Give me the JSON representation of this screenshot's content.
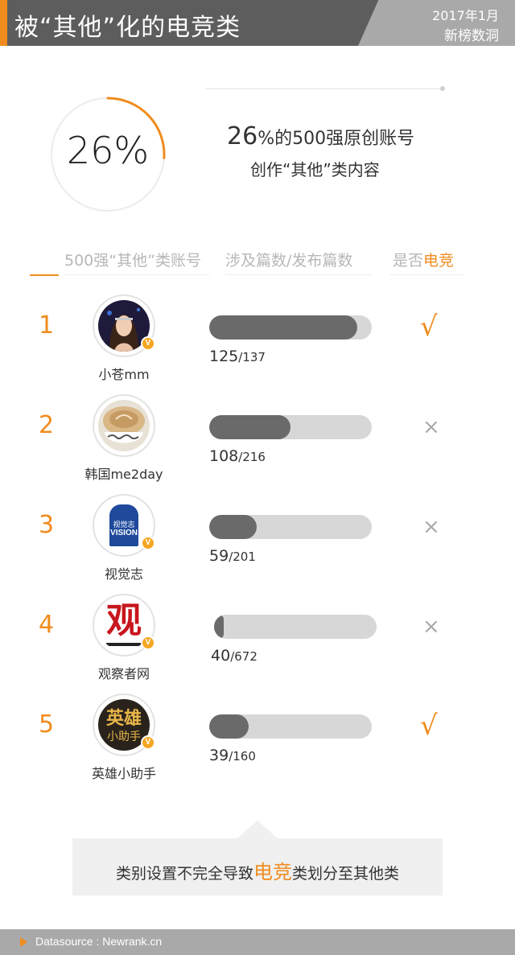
{
  "header": {
    "title": "被“其他”化的电竞类",
    "date": "2017年1月",
    "brand": "新榜数洞"
  },
  "stat": {
    "percent_value": 26,
    "ring_label": "26%",
    "line1_number": "26",
    "line1_rest": "%的500强原创账号",
    "line2": "创作“其他”类内容"
  },
  "columns": {
    "account": "500强“其他”类账号",
    "posts": "涉及篇数/发布篇数",
    "esports_prefix": "是否",
    "esports_highlight": "电竞"
  },
  "chart_data": {
    "type": "bar",
    "categories": [
      "小苍mm",
      "韩国me2day",
      "视觉志",
      "观察者网",
      "英雄小助手"
    ],
    "series": [
      {
        "values": [
          125,
          108,
          59,
          40,
          39
        ]
      },
      {
        "values": [
          137,
          216,
          201,
          672,
          160
        ]
      }
    ],
    "ranks": [
      "1",
      "2",
      "3",
      "4",
      "5"
    ],
    "is_esports": [
      true,
      false,
      false,
      false,
      true
    ]
  },
  "rows": [
    {
      "rank": "1",
      "name": "小苍mm",
      "involved": "125",
      "total": "/137",
      "verified": true,
      "esports": true
    },
    {
      "rank": "2",
      "name": "韩国me2day",
      "involved": "108",
      "total": "/216",
      "verified": false,
      "esports": false
    },
    {
      "rank": "3",
      "name": "视觉志",
      "involved": "59",
      "total": "/201",
      "verified": true,
      "esports": false
    },
    {
      "rank": "4",
      "name": "观察者网",
      "involved": "40",
      "total": "/672",
      "verified": true,
      "esports": false
    },
    {
      "rank": "5",
      "name": "英雄小助手",
      "involved": "39",
      "total": "/160",
      "verified": true,
      "esports": true
    }
  ],
  "marks": {
    "yes": "√",
    "no": "×",
    "verified_badge": "V"
  },
  "avatars": {
    "row3_text_top": "视觉志",
    "row3_text_bottom": "VISION",
    "row4_glyph": "观",
    "row5_top": "英雄",
    "row5_bottom": "小助手"
  },
  "note": {
    "before": "类别设置不完全导致",
    "highlight": "电竞",
    "after": "类划分至其他类"
  },
  "footer": {
    "text": "Datasource : Newrank.cn"
  },
  "colors": {
    "accent": "#f08c1e",
    "bar_fill": "#6a6a6a",
    "bar_track": "#d7d7d7",
    "header_bg": "#5d5d5d"
  }
}
